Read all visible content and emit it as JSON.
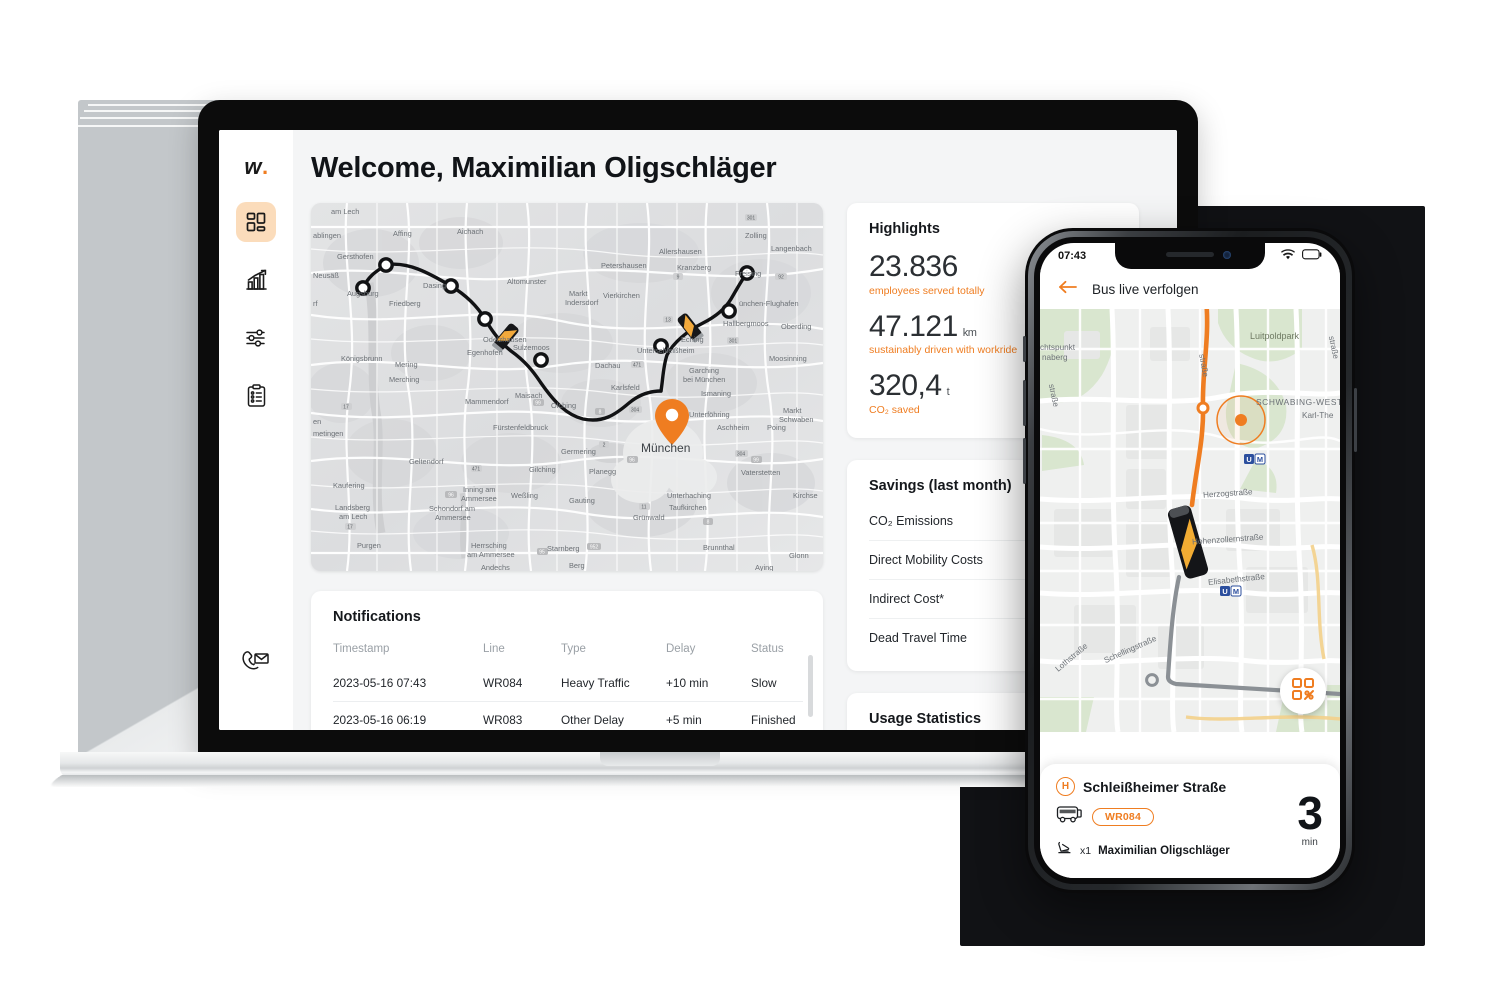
{
  "brand": {
    "logo_text": "w",
    "logo_dot": ".",
    "accent": "#ef7d21",
    "accent_soft": "#fbdcbb"
  },
  "laptop": {
    "sidebar": {
      "items": [
        {
          "name": "dashboard",
          "icon": "grid-dashboard-icon",
          "active": true
        },
        {
          "name": "statistics",
          "icon": "bar-chart-trend-icon",
          "active": false
        },
        {
          "name": "settings",
          "icon": "sliders-icon",
          "active": false
        },
        {
          "name": "reports",
          "icon": "clipboard-list-icon",
          "active": false
        }
      ],
      "bottom": {
        "name": "contact-support",
        "icon": "phone-envelope-icon"
      }
    },
    "page_title": "Welcome, Maximilian Oligschläger",
    "map": {
      "city_label": "München",
      "labels": [
        "am Lech",
        "Affing",
        "Aichach",
        "Zolling",
        "Langenbach",
        "ablingen",
        "Gersthofen",
        "Petershausen",
        "Allershausen",
        "Kranzberg",
        "Freising",
        "Neusäß",
        "Dasing",
        "Altomunster",
        "Markt Indersdorf",
        "Vierkirchen",
        "München-Flughafen",
        "Augsburg",
        "Friedberg",
        "Hallbergmoos",
        "Oberding",
        "Odelzhausen",
        "Sulzemoos",
        "Egenhofen",
        "Eching",
        "Unterschleißheim",
        "Moosinning",
        "Königsbrunn",
        "Mering",
        "Dachau",
        "Garching bei München",
        "Ismaning",
        "Merching",
        "Mammendorf",
        "Maisach",
        "Olching",
        "Karlsfeld",
        "Markt Schwaben",
        "Poing",
        "Fürstenfeldbruck",
        "Unterföhring",
        "Aschheim",
        "Geltendorf",
        "Germering",
        "Vaterstetten",
        "Kaufering",
        "Gilching",
        "Planegg",
        "Unterhaching",
        "Inning am Ammersee",
        "Weßling",
        "Gauting",
        "Taufkirchen",
        "Kirchse",
        "Landsberg am Lech",
        "Schondorf am Ammersee",
        "Grünwald",
        "Purgen",
        "Herrsching am Ammersee",
        "Starnberg",
        "Berg",
        "Brunnthal",
        "Glonn",
        "Andechs",
        "Aying",
        "meitingen",
        "erf",
        "en"
      ],
      "road_shields": [
        "301",
        "92",
        "9",
        "13",
        "301",
        "471",
        "304",
        "99",
        "2",
        "96",
        "17",
        "96",
        "11",
        "304",
        "99",
        "8",
        "95",
        "952"
      ]
    },
    "notifications": {
      "title": "Notifications",
      "columns": [
        "Timestamp",
        "Line",
        "Type",
        "Delay",
        "Status"
      ],
      "rows": [
        [
          "2023-05-16 07:43",
          "WR084",
          "Heavy Traffic",
          "+10 min",
          "Slow"
        ],
        [
          "2023-05-16 06:19",
          "WR083",
          "Other Delay",
          "+5 min",
          "Finished"
        ]
      ]
    },
    "highlights": {
      "title": "Highlights",
      "stats": [
        {
          "value": "23.836",
          "unit": "",
          "label": "employees served totally"
        },
        {
          "value": "47.121",
          "unit": "km",
          "label": "sustainably driven with workride"
        },
        {
          "value": "320,4",
          "unit": "t",
          "label": "CO₂ saved"
        }
      ]
    },
    "savings": {
      "title": "Savings (last month)",
      "rows": [
        "CO₂ Emissions",
        "Direct Mobility Costs",
        "Indirect Cost*",
        "Dead Travel Time"
      ]
    },
    "usage": {
      "title": "Usage Statistics"
    }
  },
  "phone": {
    "status": {
      "time": "07:43",
      "wifi": "wifi-icon",
      "battery": "battery-icon"
    },
    "header": {
      "back": "back-arrow-icon",
      "title": "Bus live verfolgen"
    },
    "map": {
      "labels": [
        {
          "text": "Luitpoldpark",
          "type": "park"
        },
        {
          "text": "SCHWABING-WEST",
          "type": "area"
        },
        {
          "text": "chtspunkt",
          "type": "street"
        },
        {
          "text": "naberg",
          "type": "street"
        },
        {
          "text": "Karl-The",
          "type": "street"
        },
        {
          "text": "Herzogstraße",
          "type": "street"
        },
        {
          "text": "Hohenzollernstraße",
          "type": "street"
        },
        {
          "text": "Elisabethstraße",
          "type": "street"
        },
        {
          "text": "Schellingstraße",
          "type": "street"
        },
        {
          "text": "Lothstraße",
          "type": "street"
        },
        {
          "text": "straße",
          "type": "street"
        }
      ],
      "qr_button": "qr-code-icon",
      "transit_markers": [
        "U M",
        "U M"
      ]
    },
    "panel": {
      "stop_icon": "H",
      "stop_name": "Schleißheimer Straße",
      "bus_icon": "bus-icon",
      "line": "WR084",
      "seat_icon": "seat-icon",
      "pax_count": "x1",
      "pax_name": "Maximilian Oligschläger",
      "eta_value": "3",
      "eta_unit": "min"
    }
  }
}
